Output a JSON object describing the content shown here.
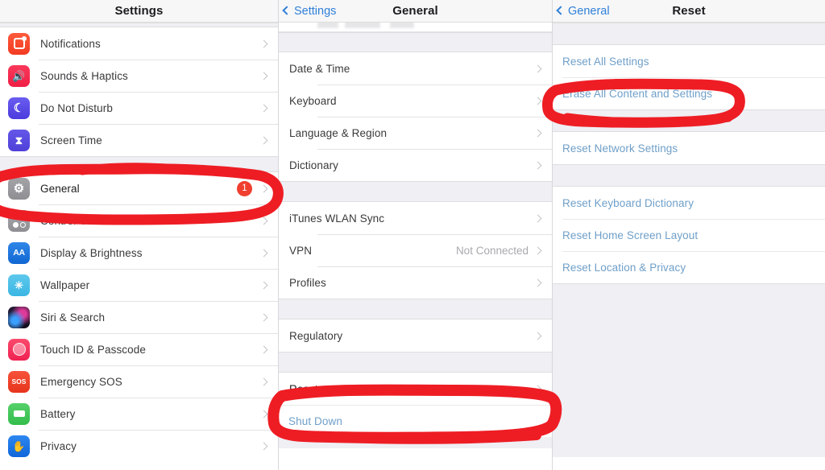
{
  "colors": {
    "annotation_red": "#ee1d24",
    "badge_red": "#f03e2f",
    "link_blue": "#4c8fd0",
    "nav_blue": "#2f7fd8",
    "group_bg": "#efeff4"
  },
  "settings_panel": {
    "title": "Settings",
    "items": [
      {
        "label": "Notifications",
        "icon": "notifications-icon",
        "chevron": true
      },
      {
        "label": "Sounds & Haptics",
        "icon": "sounds-haptics-icon",
        "chevron": true
      },
      {
        "label": "Do Not Disturb",
        "icon": "do-not-disturb-icon",
        "chevron": true
      },
      {
        "label": "Screen Time",
        "icon": "screen-time-icon",
        "chevron": true
      },
      {
        "label": "General",
        "icon": "general-gear-icon",
        "chevron": true,
        "badge": "1",
        "highlighted": true
      },
      {
        "label": "Control Center",
        "icon": "control-center-icon",
        "chevron": true
      },
      {
        "label": "Display & Brightness",
        "icon": "display-brightness-icon",
        "chevron": true
      },
      {
        "label": "Wallpaper",
        "icon": "wallpaper-icon",
        "chevron": true
      },
      {
        "label": "Siri & Search",
        "icon": "siri-search-icon",
        "chevron": true
      },
      {
        "label": "Touch ID & Passcode",
        "icon": "touch-id-passcode-icon",
        "chevron": true
      },
      {
        "label": "Emergency SOS",
        "icon": "emergency-sos-icon",
        "chevron": true
      },
      {
        "label": "Battery",
        "icon": "battery-icon",
        "chevron": true
      },
      {
        "label": "Privacy",
        "icon": "privacy-icon",
        "chevron": true
      }
    ]
  },
  "general_panel": {
    "back_label": "Settings",
    "title": "General",
    "group_a": [
      {
        "label": "Date & Time",
        "chevron": true
      },
      {
        "label": "Keyboard",
        "chevron": true
      },
      {
        "label": "Language & Region",
        "chevron": true
      },
      {
        "label": "Dictionary",
        "chevron": true
      }
    ],
    "group_b": [
      {
        "label": "iTunes WLAN Sync",
        "chevron": true
      },
      {
        "label": "VPN",
        "value": "Not Connected",
        "chevron": true
      },
      {
        "label": "Profiles",
        "chevron": true
      }
    ],
    "group_c": [
      {
        "label": "Regulatory",
        "chevron": true
      }
    ],
    "group_d": [
      {
        "label": "Reset",
        "chevron": true,
        "highlighted": true
      }
    ],
    "group_e": [
      {
        "label": "Shut Down",
        "link": true
      }
    ]
  },
  "reset_panel": {
    "back_label": "General",
    "title": "Reset",
    "group_a": [
      {
        "label": "Reset All Settings"
      },
      {
        "label": "Erase All Content and Settings",
        "highlighted": true
      }
    ],
    "group_b": [
      {
        "label": "Reset Network Settings"
      }
    ],
    "group_c": [
      {
        "label": "Reset Keyboard Dictionary"
      },
      {
        "label": "Reset Home Screen Layout"
      },
      {
        "label": "Reset Location & Privacy"
      }
    ]
  },
  "annotations": [
    {
      "name": "annotation-circle-general",
      "target": "General"
    },
    {
      "name": "annotation-circle-reset",
      "target": "Reset"
    },
    {
      "name": "annotation-circle-erase-all-content-and-settings",
      "target": "Erase All Content and Settings"
    }
  ]
}
